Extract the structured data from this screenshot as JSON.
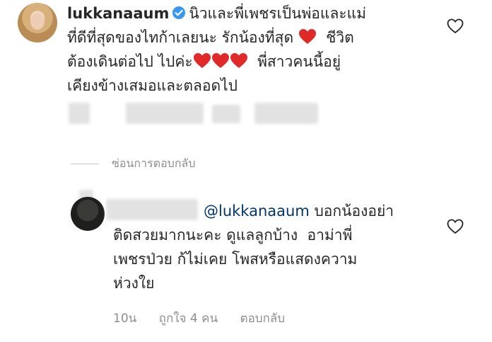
{
  "main_comment": {
    "username": "lukkanaaum",
    "line1": "นิวและพี่เพชรเป็นพ่อและแม่",
    "line2": "ที่ดีที่สุดของไทก้าเลยนะ รักน้องที่สุด",
    "line2b": "ชีวิต",
    "line3": "ต้องเดินต่อไป ไปค่ะ",
    "line3b": "พี่สาวคนนี้อยู่",
    "line4": "เคียงข้างเสมอและตลอดไป"
  },
  "replies_toggle": "ซ่อนการตอบกลับ",
  "reply": {
    "mention": "@lukkanaaum",
    "line1": "บอกน้องอย่า",
    "line2": "ติดสวยมากนะคะ ดูแลลูกบ้าง  อาม่าพี่",
    "line3": "เพชรป่วย ก้ไม่เคย โพสหรือแสดงความ",
    "line4": "ห่วงใย",
    "time": "10น",
    "likes": "ถูกใจ 4 คน",
    "reply_label": "ตอบกลับ"
  },
  "colors": {
    "heart_red": "#e02a2a",
    "verified_blue": "#3897f0",
    "meta_gray": "#8e8e8e"
  },
  "icons": [
    "verified-badge-icon",
    "red-heart-emoji-icon",
    "like-heart-outline-icon"
  ]
}
